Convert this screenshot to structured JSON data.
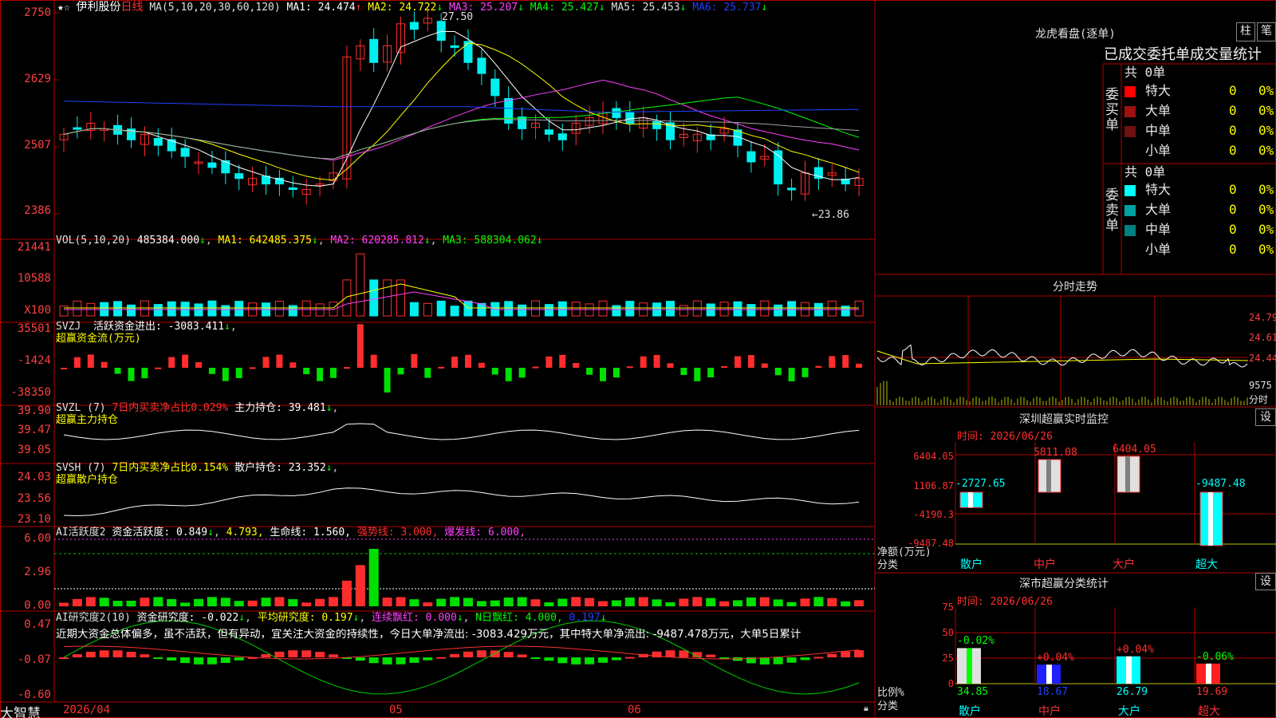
{
  "colors": {
    "up": "#ff2d2d",
    "down": "#00f0f0",
    "frame": "#b00000",
    "text": "#c8c8c8"
  },
  "header": {
    "star": "★",
    "check": "☆",
    "stock_name": "伊利股份",
    "period": "日线",
    "ma_params": "MA(5,10,20,30,60,120)",
    "ma1": "MA1: 24.474",
    "ma2": "MA2: 24.722",
    "ma3": "MA3: 25.207",
    "ma4": "MA4: 25.427",
    "ma5": "MA5: 25.453",
    "ma6": "MA6: 25.737",
    "arrow_up": "↑",
    "arrow_down": "↓",
    "high_mark": "27.50",
    "low_mark": "←23.86"
  },
  "price_axis": [
    "2750",
    "2629",
    "2507",
    "2386"
  ],
  "vol": {
    "title": "VOL(5,10,20)",
    "value": "485384.000",
    "ma1": "MA1: 642485.375",
    "ma2": "MA2: 620285.812",
    "ma3": "MA3: 588304.062",
    "axis": [
      "21441",
      "10588",
      "X100"
    ]
  },
  "svzj": {
    "title": "SVZJ",
    "label": "活跃资金进出: -3083.411",
    "sub": "超赢资金流(万元)",
    "axis": [
      "35501",
      "-1424",
      "-38350"
    ]
  },
  "svzl": {
    "title": "SVZL (7)",
    "ratio": "7日内买卖净占比0.029%",
    "hold": "主力持仓: 39.481",
    "sub": "超赢主力持仓",
    "axis": [
      "39.90",
      "39.47",
      "39.05"
    ]
  },
  "svsh": {
    "title": "SVSH (7)",
    "ratio": "7日内买卖净占比0.154%",
    "hold": "散户持仓: 23.352",
    "sub": "超赢散户持仓",
    "axis": [
      "24.03",
      "23.56",
      "23.10"
    ]
  },
  "ai_act": {
    "title": "AI活跃度2",
    "activity": "资金活跃度: 0.849",
    "v2": "4.793,",
    "life": "生命线: 1.560,",
    "strong": "强势线: 3.000,",
    "burst": "爆发线: 6.000,",
    "axis": [
      "6.00",
      "2.96",
      "0.00"
    ]
  },
  "ai_res": {
    "title": "AI研究度2(10)",
    "research": "资金研究度: -0.022",
    "avg": "平均研究度: 0.197",
    "cont": "连续飘红: 0.000",
    "nday": "N日飘红: 4.000,",
    "nval": "0.197",
    "comment": "近期大资金总体偏多，虽不活跃，但有异动，宜关注大资金的持续性，今日大单净流出: -3083.429万元，其中特大单净流出: -9487.478万元，大单5日累计",
    "axis": [
      "0.47",
      "-0.07",
      "-0.60"
    ]
  },
  "bottom": {
    "brand": "大智慧",
    "date": "2026/04",
    "m05": "05",
    "m06": "06"
  },
  "dragon": {
    "title": "龙虎看盘(逐单)",
    "btn_bar": "柱",
    "btn_pen": "笔",
    "head": "已成交委托单成交量统计",
    "buy_label": "委买单",
    "sell_label": "委卖单",
    "total": "共 0单",
    "rows": [
      {
        "name": "特大",
        "count": "0",
        "pct": "0%"
      },
      {
        "name": "大单",
        "count": "0",
        "pct": "0%"
      },
      {
        "name": "中单",
        "count": "0",
        "pct": "0%"
      },
      {
        "name": "小单",
        "count": "0",
        "pct": "0%"
      }
    ],
    "buy_colors": [
      "#ff0000",
      "#a01010",
      "#701010",
      "#000000"
    ],
    "sell_colors": [
      "#00ffff",
      "#00a0a0",
      "#008080",
      "#000000"
    ]
  },
  "minute": {
    "title": "分时走势",
    "axis": [
      "24.79",
      "24.61",
      "24.44",
      "9575",
      "分时"
    ]
  },
  "monitor": {
    "title": "深圳超赢实时监控",
    "btn": "设",
    "time": "时间: 2026/06/26",
    "axis": [
      "6404.05",
      "1106.87",
      "-4190.3",
      "-9487.48"
    ],
    "ylabel1": "净额(万元)",
    "ylabel2": "分类",
    "cats": [
      "散户",
      "中户",
      "大户",
      "超大"
    ],
    "values": [
      -2727.65,
      5811.08,
      6404.05,
      -9487.48
    ],
    "value_labels": [
      "-2727.65",
      "5811.08",
      "6404.05",
      "-9487.48"
    ]
  },
  "stats": {
    "title": "深市超赢分类统计",
    "btn": "设",
    "time": "时间: 2026/06/26",
    "axis": [
      "75",
      "50",
      "25",
      "0"
    ],
    "ylabel1": "比例%",
    "ylabel2": "分类",
    "cats": [
      "散户",
      "中户",
      "大户",
      "超大"
    ],
    "values": [
      34.85,
      18.67,
      26.79,
      19.69
    ],
    "value_labels": [
      "34.85",
      "18.67",
      "26.79",
      "19.69"
    ],
    "changes": [
      "-0.02%",
      "+0.04%",
      "+0.04%",
      "-0.06%"
    ]
  }
}
